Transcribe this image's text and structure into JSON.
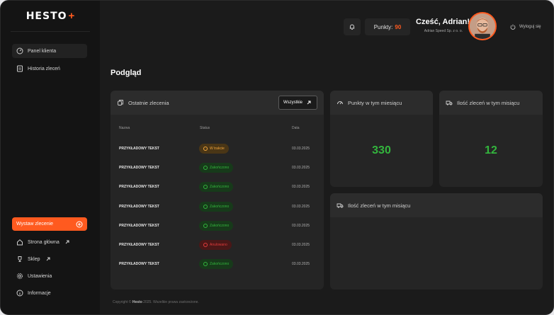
{
  "brand": {
    "name": "HESTO",
    "plus": "+"
  },
  "sidebar": {
    "items": [
      {
        "label": "Panel klienta",
        "icon": "gauge-icon",
        "active": true
      },
      {
        "label": "Historia zleceń",
        "icon": "history-icon",
        "active": false
      }
    ],
    "cta": {
      "label": "Wystaw zlecenie",
      "icon": "plus-circle-icon"
    },
    "bottom_items": [
      {
        "label": "Strona główna",
        "icon": "home-icon",
        "external": true
      },
      {
        "label": "Sklep",
        "icon": "trophy-icon",
        "external": true
      },
      {
        "label": "Ustawienia",
        "icon": "gear-icon",
        "external": false
      },
      {
        "label": "Informacje",
        "icon": "info-icon",
        "external": false
      }
    ]
  },
  "header": {
    "points_label": "Punkty:",
    "points_value": "90",
    "greeting": "Cześć, Adrian!",
    "company": "Adrian Speed Sp. z o. o.",
    "logout_label": "Wyloguj się"
  },
  "page": {
    "title": "Podgląd"
  },
  "orders": {
    "title": "Ostatnie zlecenia",
    "all_button": "Wszystkie",
    "columns": [
      "Nazwa",
      "Status",
      "Data"
    ],
    "rows": [
      {
        "name": "PRZYKŁADOWY TEKST",
        "status": "W trakcie",
        "type": "progress",
        "date": "03.03.2025"
      },
      {
        "name": "PRZYKŁADOWY TEKST",
        "status": "Zakończono",
        "type": "done",
        "date": "03.03.2025"
      },
      {
        "name": "PRZYKŁADOWY TEKST",
        "status": "Zakończono",
        "type": "done",
        "date": "03.03.2025"
      },
      {
        "name": "PRZYKŁADOWY TEKST",
        "status": "Zakończono",
        "type": "done",
        "date": "03.03.2025"
      },
      {
        "name": "PRZYKŁADOWY TEKST",
        "status": "Zakończono",
        "type": "done",
        "date": "03.03.2025"
      },
      {
        "name": "PRZYKŁADOWY TEKST",
        "status": "Anulowano",
        "type": "cancel",
        "date": "03.03.2025"
      },
      {
        "name": "PRZYKŁADOWY TEKST",
        "status": "Zakończono",
        "type": "done",
        "date": "03.03.2025"
      }
    ]
  },
  "kpi_points": {
    "title": "Punkty w tym miesiącu",
    "value": "330"
  },
  "kpi_orders": {
    "title": "Ilość zleceń w tym misiącu",
    "value": "12"
  },
  "chart_card": {
    "title": "Ilość zleceń w tym misiącu"
  },
  "footer": {
    "prefix": "Copyright ©",
    "brand": "Hesto",
    "suffix": "2025. Wszelkie prawa zastrzeżone."
  },
  "colors": {
    "accent": "#ff5a1f",
    "success": "#33b53d",
    "warning": "#f0a53c",
    "danger": "#e23c3c"
  }
}
